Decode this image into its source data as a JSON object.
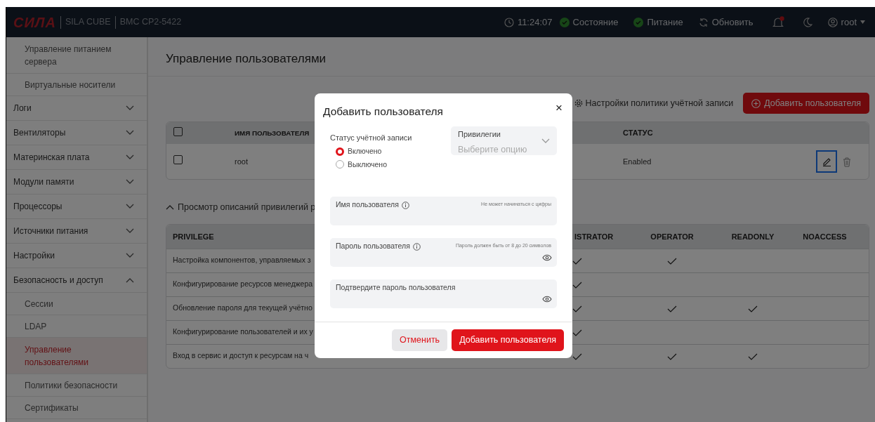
{
  "header": {
    "logo": "СИЛА",
    "product": "SILA CUBE",
    "model": "BMC  CP2-5422",
    "time": "11:24:07",
    "indicators": [
      {
        "label": "Состояние",
        "ok": true
      },
      {
        "label": "Питание",
        "ok": true
      }
    ],
    "refresh": "Обновить",
    "notifications": {
      "unread": true
    },
    "user": "root"
  },
  "sidebar": {
    "items": [
      {
        "kind": "sub",
        "label": "Управление питанием сервера",
        "selected": false
      },
      {
        "kind": "sub",
        "label": "Виртуальные носители",
        "selected": false
      },
      {
        "kind": "group",
        "label": "Логи",
        "expanded": false
      },
      {
        "kind": "group",
        "label": "Вентиляторы",
        "expanded": false
      },
      {
        "kind": "group",
        "label": "Материнская плата",
        "expanded": false
      },
      {
        "kind": "group",
        "label": "Модули памяти",
        "expanded": false
      },
      {
        "kind": "group",
        "label": "Процессоры",
        "expanded": false
      },
      {
        "kind": "group",
        "label": "Источники питания",
        "expanded": false
      },
      {
        "kind": "group",
        "label": "Настройки",
        "expanded": false
      },
      {
        "kind": "group",
        "label": "Безопасность и доступ",
        "expanded": true
      },
      {
        "kind": "sub",
        "label": "Сессии",
        "selected": false
      },
      {
        "kind": "sub",
        "label": "LDAP",
        "selected": false
      },
      {
        "kind": "sub",
        "label": "Управление пользователями",
        "selected": true
      },
      {
        "kind": "sub",
        "label": "Политики безопасности",
        "selected": false
      },
      {
        "kind": "sub",
        "label": "Сертификаты",
        "selected": false
      }
    ]
  },
  "page": {
    "title": "Управление пользователями",
    "policy_link": "Настройки политики учётной записи",
    "add_button": "Добавить пользователя",
    "users_table": {
      "all_checked": false,
      "columns": [
        "ИМЯ ПОЛЬЗОВАТЕЛЯ",
        "СТАТУС"
      ],
      "rows": [
        {
          "checked": false,
          "name": "root",
          "status": "Enabled",
          "edit_focused": true
        }
      ]
    },
    "privileges_toggle": {
      "label": "Просмотр описаний привилегий р",
      "expanded": true
    },
    "privileges_table": {
      "columns": [
        "PRIVILEGE",
        "ISTRATOR",
        "OPERATOR",
        "READONLY",
        "NOACCESS"
      ],
      "rows": [
        {
          "privilege": "Настройка компонентов, управляемых з",
          "access": [
            true,
            true,
            false,
            false
          ]
        },
        {
          "privilege": "Конфигурирование ресурсов менеджера",
          "access": [
            true,
            false,
            false,
            false
          ]
        },
        {
          "privilege": "Обновление пароля для текущей учётно",
          "access": [
            true,
            true,
            true,
            false
          ]
        },
        {
          "privilege": "Конфигурирование пользователей и их у",
          "access": [
            true,
            false,
            false,
            false
          ]
        },
        {
          "privilege": "Вход в сервис и доступ к ресурсам на ч",
          "access": [
            true,
            true,
            true,
            false
          ]
        }
      ]
    }
  },
  "dialog": {
    "title": "Добавить пользователя",
    "close": "×",
    "status_label": "Статус учётной записи",
    "radios": [
      {
        "label": "Включено",
        "selected": true
      },
      {
        "label": "Выключено",
        "selected": false
      }
    ],
    "privileges": {
      "label": "Привилегии",
      "placeholder": "Выберите опцию"
    },
    "fields": [
      {
        "kind": "text",
        "label": "Имя пользователя",
        "info": true,
        "hint": "Не может начинаться с цифры"
      },
      {
        "kind": "password",
        "label": "Пароль пользователя",
        "info": true,
        "hint": "Пароль должен быть от 8 до 20 символов"
      },
      {
        "kind": "password",
        "label": "Подтвердите пароль пользователя",
        "info": false
      }
    ],
    "cancel": "Отменить",
    "submit": "Добавить пользователя"
  }
}
